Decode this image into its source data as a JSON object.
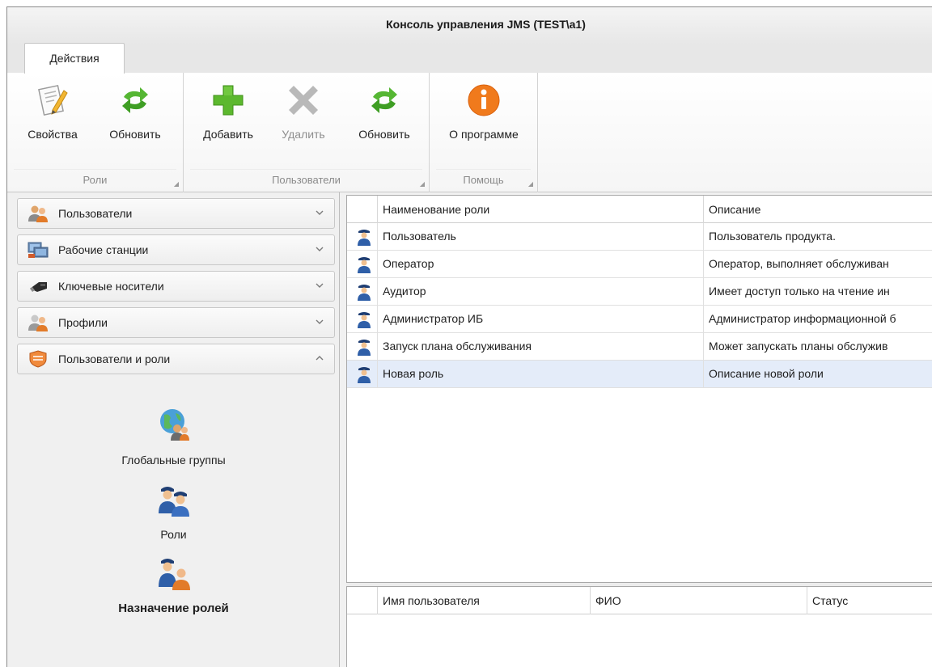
{
  "window": {
    "title": "Консоль управления JMS (TEST\\a1)"
  },
  "ribbon": {
    "tabs": [
      {
        "label": "Действия"
      }
    ],
    "groups": [
      {
        "caption": "Роли",
        "buttons": [
          {
            "label": "Свойства",
            "icon": "properties-icon",
            "enabled": true
          },
          {
            "label": "Обновить",
            "icon": "refresh-icon",
            "enabled": true
          }
        ]
      },
      {
        "caption": "Пользователи",
        "buttons": [
          {
            "label": "Добавить",
            "icon": "add-icon",
            "enabled": true
          },
          {
            "label": "Удалить",
            "icon": "delete-icon",
            "enabled": false
          },
          {
            "label": "Обновить",
            "icon": "refresh-icon",
            "enabled": true
          }
        ]
      },
      {
        "caption": "Помощь",
        "buttons": [
          {
            "label": "О программе",
            "icon": "info-icon",
            "enabled": true
          }
        ]
      }
    ]
  },
  "nav": {
    "sections": [
      {
        "label": "Пользователи",
        "icon": "users-icon",
        "expanded": false
      },
      {
        "label": "Рабочие станции",
        "icon": "workstations-icon",
        "expanded": false
      },
      {
        "label": "Ключевые носители",
        "icon": "usb-key-icon",
        "expanded": false
      },
      {
        "label": "Профили",
        "icon": "profiles-icon",
        "expanded": false
      },
      {
        "label": "Пользователи и роли",
        "icon": "shield-icon",
        "expanded": true
      }
    ],
    "items": [
      {
        "label": "Глобальные группы",
        "icon": "global-groups-icon"
      },
      {
        "label": "Роли",
        "icon": "roles-icon"
      },
      {
        "label": "Назначение ролей",
        "icon": "role-assignment-icon",
        "active": true
      }
    ]
  },
  "roles_grid": {
    "columns": [
      "Наименование роли",
      "Описание"
    ],
    "rows": [
      {
        "name": "Пользователь",
        "description": "Пользователь продукта."
      },
      {
        "name": "Оператор",
        "description": "Оператор, выполняет обслуживан"
      },
      {
        "name": "Аудитор",
        "description": "Имеет доступ только на чтение ин"
      },
      {
        "name": "Администратор ИБ",
        "description": "Администратор информационной б"
      },
      {
        "name": "Запуск плана обслуживания",
        "description": "Может запускать планы обслужив"
      },
      {
        "name": "Новая роль",
        "description": "Описание новой роли",
        "selected": true
      }
    ]
  },
  "users_grid": {
    "columns": [
      "Имя пользователя",
      "ФИО",
      "Статус"
    ],
    "rows": []
  },
  "colors": {
    "add_green": "#5cb82e",
    "refresh_green": "#4caf2c",
    "info_orange": "#f07a1c",
    "selected_row": "#e4ecf9"
  }
}
